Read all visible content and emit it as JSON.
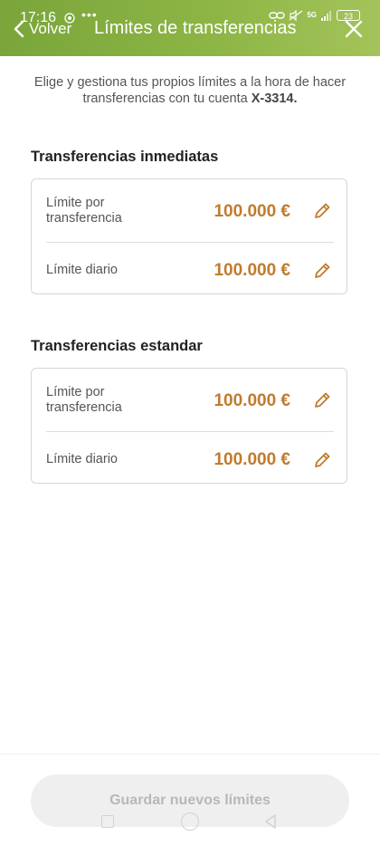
{
  "status_bar": {
    "time": "17:16",
    "dots": "•••",
    "network": "5G",
    "battery": "23"
  },
  "header": {
    "back_label": "Volver",
    "title": "Límites de transferencias"
  },
  "intro": {
    "text": "Elige y gestiona tus propios límites a la hora de hacer transferencias con tu cuenta ",
    "account": "X-3314."
  },
  "sections": [
    {
      "title": "Transferencias inmediatas",
      "rows": [
        {
          "label": "Límite por transferencia",
          "value": "100.000 €"
        },
        {
          "label": "Límite diario",
          "value": "100.000 €"
        }
      ]
    },
    {
      "title": "Transferencias estandar",
      "rows": [
        {
          "label": "Límite por transferencia",
          "value": "100.000 €"
        },
        {
          "label": "Límite diario",
          "value": "100.000 €"
        }
      ]
    }
  ],
  "footer": {
    "save_label": "Guardar nuevos límites"
  },
  "colors": {
    "header_green": "#8cb545",
    "amount_orange": "#c07b2e",
    "disabled_button": "#efefef"
  },
  "icons": {
    "back": "chevron-left-icon",
    "close": "close-icon",
    "edit": "pencil-icon"
  }
}
